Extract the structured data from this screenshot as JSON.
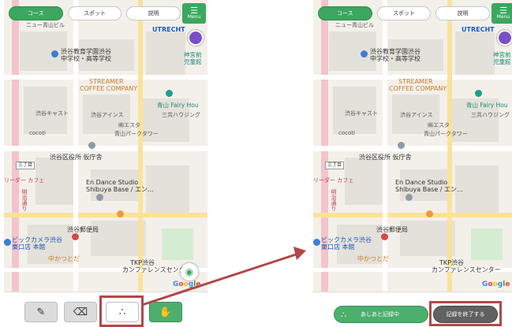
{
  "tabs": {
    "course": "コース",
    "spot": "スポット",
    "explain": "説明"
  },
  "menu": {
    "label": "Menu",
    "icon": "hamburger-icon"
  },
  "map": {
    "labels": {
      "new_aoyama_building": "ニュー青山ビル",
      "utrecht": "UTRECHT",
      "shibuya_school_1": "渋谷教育学園渋谷",
      "shibuya_school_2": "中学校・高等学校",
      "jingumae_1": "神宮前",
      "jingumae_2": "児童館",
      "streamer_1": "STREAMER",
      "streamer_2": "COFFEE COMPANY",
      "aoyama_fairy": "青山 Fairy Hou",
      "shibuya_castle": "渋谷キャスト",
      "sankyo": "三共ハウジング",
      "aines": "渋谷アインス",
      "ester": "㈱エスタ",
      "aoyama_park": "青山パークタワー",
      "cocoti": "cocoti",
      "shibuya_ward": "渋谷区役所 仮庁舎",
      "riidaa_cafe": "リーダー カフェ",
      "en_dance_1": "En Dance Studio",
      "en_dance_2": "Shibuya Base / エン…",
      "shibuya_post": "渋谷郵便局",
      "bic_camera_1": "ビックカメラ渋谷",
      "bic_camera_2": "東口店 本館",
      "nakakatsu": "中かつとだ",
      "tkp_1": "TKP渋谷",
      "tkp_2": "カンファレンスセンター",
      "meiji_dori": "明治通り",
      "google": "Google",
      "mark_1": "三丁目"
    }
  },
  "left_toolbar": {
    "pencil": "✎",
    "eraser": "⌫",
    "dots": "∴",
    "hands": "✋"
  },
  "right_controls": {
    "record_start": "あしあと記録中",
    "record_end": "記録を終了する"
  },
  "colors": {
    "accent_green": "#3ba75f",
    "highlight_red": "#b0474a"
  }
}
